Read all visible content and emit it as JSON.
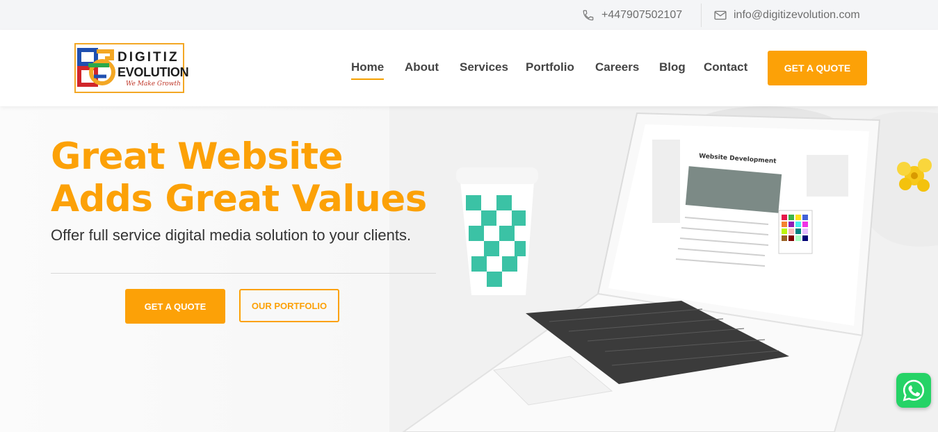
{
  "topbar": {
    "phone": "+447907502107",
    "email": "info@digitizevolution.com",
    "phone_icon": "phone-icon",
    "email_icon": "envelope-icon"
  },
  "logo": {
    "line1": "DIGITIZ",
    "line2": "EVOLUTION",
    "tagline": "We Make Growth"
  },
  "nav": {
    "items": [
      {
        "label": "Home",
        "active": true
      },
      {
        "label": "About"
      },
      {
        "label": "Services"
      },
      {
        "label": "Portfolio"
      },
      {
        "label": "Careers"
      },
      {
        "label": "Blog"
      },
      {
        "label": "Contact"
      }
    ],
    "cta": "GET A QUOTE"
  },
  "hero": {
    "title_line1": "Great Website",
    "title_line2": "Adds Great Values",
    "subtitle": "Offer full service digital media solution to your clients.",
    "btn_quote": "GET A QUOTE",
    "btn_portfolio": "OUR PORTFOLIO",
    "screen_heading": "Website Development"
  },
  "floating": {
    "whatsapp_icon": "whatsapp-icon"
  },
  "colors": {
    "accent": "#fca107",
    "whatsapp": "#25d366",
    "text": "#333333"
  }
}
